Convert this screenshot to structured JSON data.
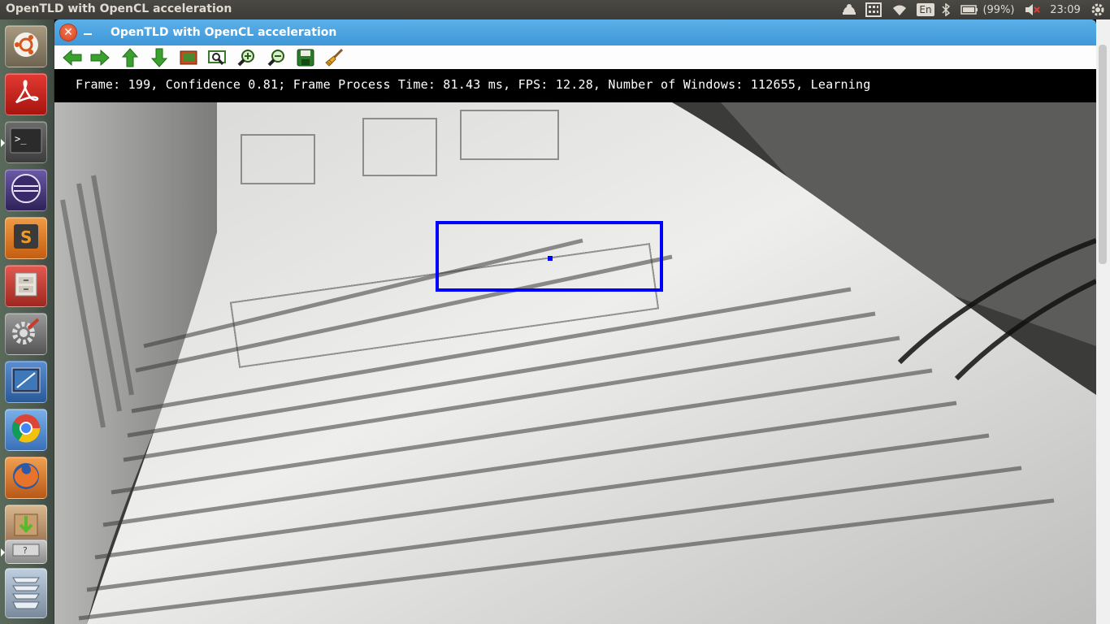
{
  "panel": {
    "title": "OpenTLD with OpenCL acceleration",
    "battery": "(99%)",
    "keyboard": "En",
    "clock": "23:09"
  },
  "launcher": {
    "items": [
      {
        "name": "dash-icon",
        "color": "#8a7e6a"
      },
      {
        "name": "adobe-reader-icon",
        "color": "#c8201e"
      },
      {
        "name": "terminal-icon",
        "color": "#2b2b2b"
      },
      {
        "name": "eclipse-icon",
        "color": "#3b2a6b"
      },
      {
        "name": "sublime-text-icon",
        "color": "#e8822a"
      },
      {
        "name": "file-cabinet-icon",
        "color": "#c8423c"
      },
      {
        "name": "system-settings-icon",
        "color": "#7a7a7a"
      },
      {
        "name": "workspace-switcher-icon",
        "color": "#3f78b8"
      },
      {
        "name": "chrome-icon",
        "color": "#4a8ad8"
      },
      {
        "name": "firefox-icon",
        "color": "#e8732a"
      },
      {
        "name": "archive-install-icon",
        "color": "#c09060"
      },
      {
        "name": "unknown-drive-icon",
        "color": "#9a9a9a"
      },
      {
        "name": "trash-stack-icon",
        "color": "#a8b8c8"
      }
    ]
  },
  "window": {
    "title": "OpenTLD with OpenCL acceleration",
    "close_glyph": "✕",
    "toolbar": [
      {
        "name": "back-arrow-icon"
      },
      {
        "name": "forward-arrow-icon"
      },
      {
        "name": "up-arrow-icon"
      },
      {
        "name": "down-arrow-icon"
      },
      {
        "name": "image-icon"
      },
      {
        "name": "zoom-fit-icon"
      },
      {
        "name": "zoom-in-icon"
      },
      {
        "name": "zoom-out-icon"
      },
      {
        "name": "save-icon"
      },
      {
        "name": "clear-broom-icon"
      }
    ],
    "status": "Frame: 199, Confidence 0.81; Frame Process Time: 81.43 ms, FPS: 12.28, Number of Windows: 112655, Learning"
  },
  "colors": {
    "titlebar": "#4aa3e0",
    "track_box": "#0000ff",
    "toolbar_arrow": "#3aa02e"
  }
}
